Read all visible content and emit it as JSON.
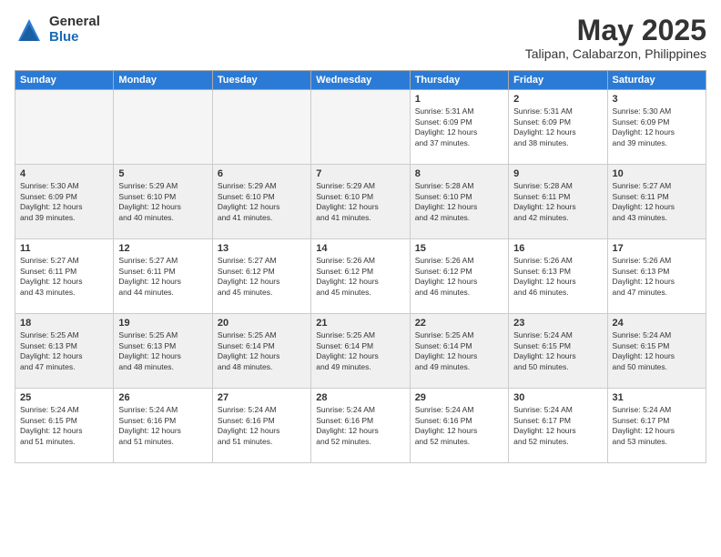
{
  "logo": {
    "general": "General",
    "blue": "Blue"
  },
  "title": "May 2025",
  "subtitle": "Talipan, Calabarzon, Philippines",
  "days_of_week": [
    "Sunday",
    "Monday",
    "Tuesday",
    "Wednesday",
    "Thursday",
    "Friday",
    "Saturday"
  ],
  "weeks": [
    [
      {
        "num": "",
        "detail": ""
      },
      {
        "num": "",
        "detail": ""
      },
      {
        "num": "",
        "detail": ""
      },
      {
        "num": "",
        "detail": ""
      },
      {
        "num": "1",
        "detail": "Sunrise: 5:31 AM\nSunset: 6:09 PM\nDaylight: 12 hours\nand 37 minutes."
      },
      {
        "num": "2",
        "detail": "Sunrise: 5:31 AM\nSunset: 6:09 PM\nDaylight: 12 hours\nand 38 minutes."
      },
      {
        "num": "3",
        "detail": "Sunrise: 5:30 AM\nSunset: 6:09 PM\nDaylight: 12 hours\nand 39 minutes."
      }
    ],
    [
      {
        "num": "4",
        "detail": "Sunrise: 5:30 AM\nSunset: 6:09 PM\nDaylight: 12 hours\nand 39 minutes."
      },
      {
        "num": "5",
        "detail": "Sunrise: 5:29 AM\nSunset: 6:10 PM\nDaylight: 12 hours\nand 40 minutes."
      },
      {
        "num": "6",
        "detail": "Sunrise: 5:29 AM\nSunset: 6:10 PM\nDaylight: 12 hours\nand 41 minutes."
      },
      {
        "num": "7",
        "detail": "Sunrise: 5:29 AM\nSunset: 6:10 PM\nDaylight: 12 hours\nand 41 minutes."
      },
      {
        "num": "8",
        "detail": "Sunrise: 5:28 AM\nSunset: 6:10 PM\nDaylight: 12 hours\nand 42 minutes."
      },
      {
        "num": "9",
        "detail": "Sunrise: 5:28 AM\nSunset: 6:11 PM\nDaylight: 12 hours\nand 42 minutes."
      },
      {
        "num": "10",
        "detail": "Sunrise: 5:27 AM\nSunset: 6:11 PM\nDaylight: 12 hours\nand 43 minutes."
      }
    ],
    [
      {
        "num": "11",
        "detail": "Sunrise: 5:27 AM\nSunset: 6:11 PM\nDaylight: 12 hours\nand 43 minutes."
      },
      {
        "num": "12",
        "detail": "Sunrise: 5:27 AM\nSunset: 6:11 PM\nDaylight: 12 hours\nand 44 minutes."
      },
      {
        "num": "13",
        "detail": "Sunrise: 5:27 AM\nSunset: 6:12 PM\nDaylight: 12 hours\nand 45 minutes."
      },
      {
        "num": "14",
        "detail": "Sunrise: 5:26 AM\nSunset: 6:12 PM\nDaylight: 12 hours\nand 45 minutes."
      },
      {
        "num": "15",
        "detail": "Sunrise: 5:26 AM\nSunset: 6:12 PM\nDaylight: 12 hours\nand 46 minutes."
      },
      {
        "num": "16",
        "detail": "Sunrise: 5:26 AM\nSunset: 6:13 PM\nDaylight: 12 hours\nand 46 minutes."
      },
      {
        "num": "17",
        "detail": "Sunrise: 5:26 AM\nSunset: 6:13 PM\nDaylight: 12 hours\nand 47 minutes."
      }
    ],
    [
      {
        "num": "18",
        "detail": "Sunrise: 5:25 AM\nSunset: 6:13 PM\nDaylight: 12 hours\nand 47 minutes."
      },
      {
        "num": "19",
        "detail": "Sunrise: 5:25 AM\nSunset: 6:13 PM\nDaylight: 12 hours\nand 48 minutes."
      },
      {
        "num": "20",
        "detail": "Sunrise: 5:25 AM\nSunset: 6:14 PM\nDaylight: 12 hours\nand 48 minutes."
      },
      {
        "num": "21",
        "detail": "Sunrise: 5:25 AM\nSunset: 6:14 PM\nDaylight: 12 hours\nand 49 minutes."
      },
      {
        "num": "22",
        "detail": "Sunrise: 5:25 AM\nSunset: 6:14 PM\nDaylight: 12 hours\nand 49 minutes."
      },
      {
        "num": "23",
        "detail": "Sunrise: 5:24 AM\nSunset: 6:15 PM\nDaylight: 12 hours\nand 50 minutes."
      },
      {
        "num": "24",
        "detail": "Sunrise: 5:24 AM\nSunset: 6:15 PM\nDaylight: 12 hours\nand 50 minutes."
      }
    ],
    [
      {
        "num": "25",
        "detail": "Sunrise: 5:24 AM\nSunset: 6:15 PM\nDaylight: 12 hours\nand 51 minutes."
      },
      {
        "num": "26",
        "detail": "Sunrise: 5:24 AM\nSunset: 6:16 PM\nDaylight: 12 hours\nand 51 minutes."
      },
      {
        "num": "27",
        "detail": "Sunrise: 5:24 AM\nSunset: 6:16 PM\nDaylight: 12 hours\nand 51 minutes."
      },
      {
        "num": "28",
        "detail": "Sunrise: 5:24 AM\nSunset: 6:16 PM\nDaylight: 12 hours\nand 52 minutes."
      },
      {
        "num": "29",
        "detail": "Sunrise: 5:24 AM\nSunset: 6:16 PM\nDaylight: 12 hours\nand 52 minutes."
      },
      {
        "num": "30",
        "detail": "Sunrise: 5:24 AM\nSunset: 6:17 PM\nDaylight: 12 hours\nand 52 minutes."
      },
      {
        "num": "31",
        "detail": "Sunrise: 5:24 AM\nSunset: 6:17 PM\nDaylight: 12 hours\nand 53 minutes."
      }
    ]
  ]
}
